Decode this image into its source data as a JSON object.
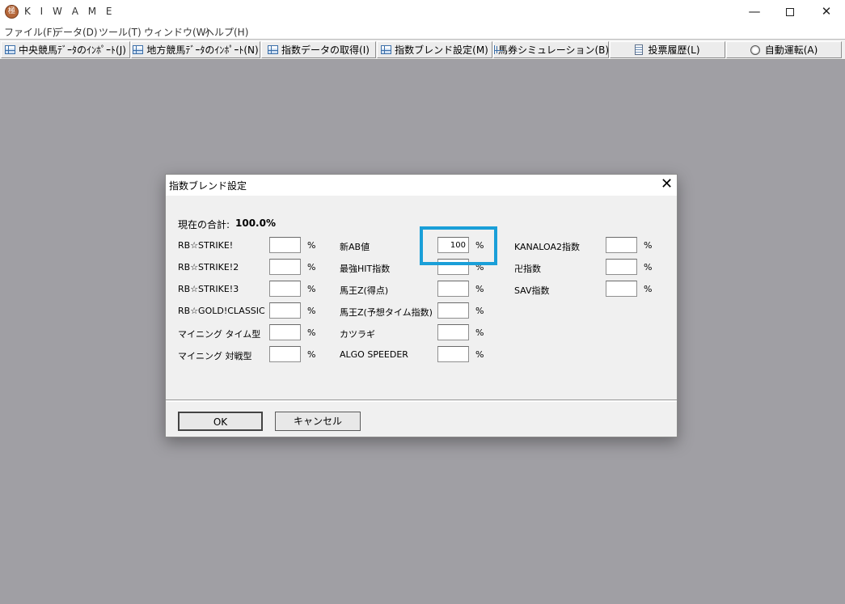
{
  "app": {
    "title": "K I W A M E",
    "icon_glyph": "極"
  },
  "window_controls": {
    "minimize": "—",
    "close": "✕"
  },
  "menu": [
    {
      "label": "ファイル(F)"
    },
    {
      "label": "データ(D)"
    },
    {
      "label": "ツール(T)"
    },
    {
      "label": "ウィンドウ(W)"
    },
    {
      "label": "ヘルプ(H)"
    }
  ],
  "toolbar": [
    {
      "label": "中央競馬ﾃﾞｰﾀのｲﾝﾎﾟｰﾄ(J)",
      "icon": "grid-icon"
    },
    {
      "label": "地方競馬ﾃﾞｰﾀのｲﾝﾎﾟｰﾄ(N)",
      "icon": "grid-icon"
    },
    {
      "label": "指数データの取得(I)",
      "icon": "grid-icon"
    },
    {
      "label": "指数ブレンド設定(M)",
      "icon": "grid-icon"
    },
    {
      "label": "馬券シミュレーション(B)",
      "icon": "grid-icon"
    },
    {
      "label": "投票履歴(L)",
      "icon": "document-icon"
    },
    {
      "label": "自動運転(A)",
      "icon": "clock-icon"
    }
  ],
  "dialog": {
    "title": "指数ブレンド設定",
    "close": "✕",
    "total_label": "現在の合計:",
    "total_value": "100.0%",
    "percent_sign": "%",
    "columns": [
      [
        {
          "label": "RB☆STRIKE!",
          "value": ""
        },
        {
          "label": "RB☆STRIKE!2",
          "value": ""
        },
        {
          "label": "RB☆STRIKE!3",
          "value": ""
        },
        {
          "label": "RB☆GOLD!CLASSIC",
          "value": ""
        },
        {
          "label": "マイニング タイム型",
          "value": ""
        },
        {
          "label": "マイニング 対戦型",
          "value": ""
        }
      ],
      [
        {
          "label": "新AB値",
          "value": "100"
        },
        {
          "label": "最強HIT指数",
          "value": ""
        },
        {
          "label": "馬王Z(得点)",
          "value": ""
        },
        {
          "label": "馬王Z(予想タイム指数)",
          "value": ""
        },
        {
          "label": "カツラギ",
          "value": ""
        },
        {
          "label": "ALGO SPEEDER",
          "value": ""
        }
      ],
      [
        {
          "label": "KANALOA2指数",
          "value": ""
        },
        {
          "label": "卍指数",
          "value": ""
        },
        {
          "label": "SAV指数",
          "value": ""
        }
      ]
    ],
    "ok_label": "OK",
    "cancel_label": "キャンセル"
  },
  "colors": {
    "background": "#a09fa4",
    "highlight": "#1a9fd8",
    "dialog": "#f0f0f0"
  }
}
